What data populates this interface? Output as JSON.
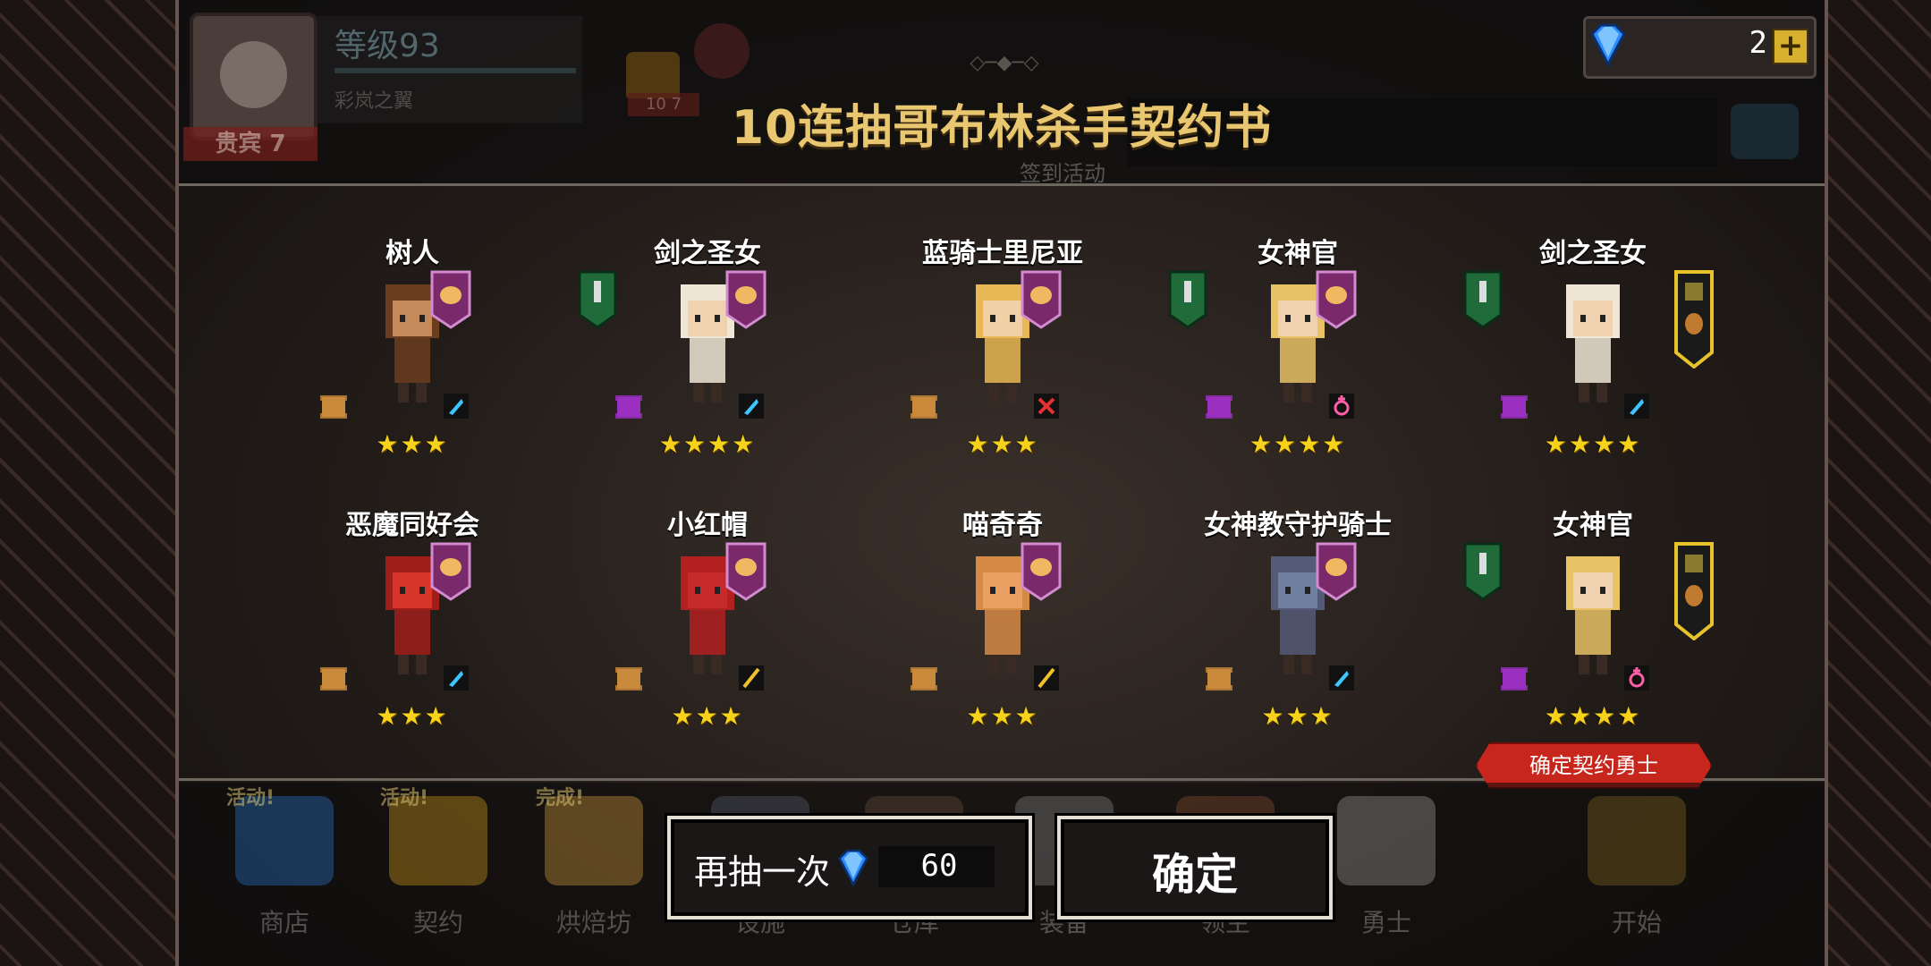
{
  "player": {
    "level_text": "等级93",
    "name": "彩岚之翼",
    "rank_label": "贵宾 7",
    "crown_label": "10 7"
  },
  "currency": {
    "gem_count": "2",
    "add_label": "+"
  },
  "header": {
    "title": "10连抽哥布林杀手契约书",
    "signin_label": "签到活动"
  },
  "cards": [
    {
      "name": "树人",
      "stars": "★★★",
      "element": "blue-feather-icon",
      "scroll": "bronze",
      "tier": ""
    },
    {
      "name": "剑之圣女",
      "stars": "★★★★",
      "element": "blue-feather-icon",
      "scroll": "purple",
      "tier": ""
    },
    {
      "name": "蓝骑士里尼亚",
      "stars": "★★★",
      "element": "red-sword-icon",
      "scroll": "bronze",
      "tier": ""
    },
    {
      "name": "女神官",
      "stars": "★★★★",
      "element": "pink-symbol-icon",
      "scroll": "purple",
      "tier": ""
    },
    {
      "name": "剑之圣女",
      "stars": "★★★★",
      "element": "blue-feather-icon",
      "scroll": "purple",
      "tier": "gold"
    },
    {
      "name": "恶魔同好会",
      "stars": "★★★",
      "element": "blue-feather-icon",
      "scroll": "bronze",
      "tier": ""
    },
    {
      "name": "小红帽",
      "stars": "★★★",
      "element": "gold-wand-icon",
      "scroll": "bronze",
      "tier": ""
    },
    {
      "name": "喵奇奇",
      "stars": "★★★",
      "element": "gold-wand-icon",
      "scroll": "bronze",
      "tier": ""
    },
    {
      "name": "女神教守护骑士",
      "stars": "★★★",
      "element": "blue-feather-icon",
      "scroll": "bronze",
      "tier": ""
    },
    {
      "name": "女神官",
      "stars": "★★★★",
      "element": "pink-symbol-icon",
      "scroll": "purple",
      "tier": "gold"
    }
  ],
  "confirm_tag": "确定契约勇士",
  "buttons": {
    "again_label": "再抽一次",
    "again_cost": "60",
    "ok_label": "确定"
  },
  "nav": [
    {
      "label": "商店",
      "badge": "活动!"
    },
    {
      "label": "契约",
      "badge": "活动!"
    },
    {
      "label": "烘焙坊",
      "badge": "完成!"
    },
    {
      "label": "设施",
      "badge": ""
    },
    {
      "label": "仓库",
      "badge": ""
    },
    {
      "label": "装备",
      "badge": ""
    },
    {
      "label": "领主",
      "badge": ""
    },
    {
      "label": "勇士",
      "badge": ""
    },
    {
      "label": "开始",
      "badge": ""
    }
  ],
  "colors": {
    "title_gold": "#e8c770",
    "star_yellow": "#f7d21a",
    "tag_red": "#c7261d",
    "gem_blue": "#2a8cff"
  }
}
